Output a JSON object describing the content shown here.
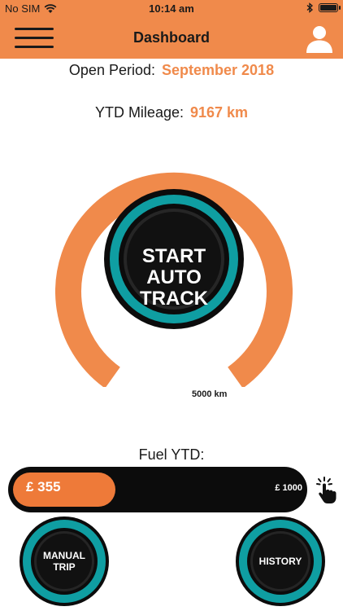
{
  "status_bar": {
    "carrier": "No SIM",
    "time": "10:14 am"
  },
  "header": {
    "title": "Dashboard"
  },
  "open_period": {
    "label": "Open Period:",
    "value": "September 2018"
  },
  "ytd_mileage": {
    "label": "YTD Mileage:",
    "value": "9167 km"
  },
  "auto_track": {
    "line1": "START",
    "line2": "AUTO",
    "line3": "TRACK",
    "max_label": "5000 km"
  },
  "fuel": {
    "label": "Fuel YTD:",
    "value": "£ 355",
    "max": "£ 1000",
    "fraction": 0.355
  },
  "buttons": {
    "manual_trip_line1": "MANUAL",
    "manual_trip_line2": "TRIP",
    "history": "HISTORY"
  },
  "colors": {
    "accent": "#f08a4b",
    "teal": "#0f9ea2",
    "dark": "#0c0c0c"
  }
}
